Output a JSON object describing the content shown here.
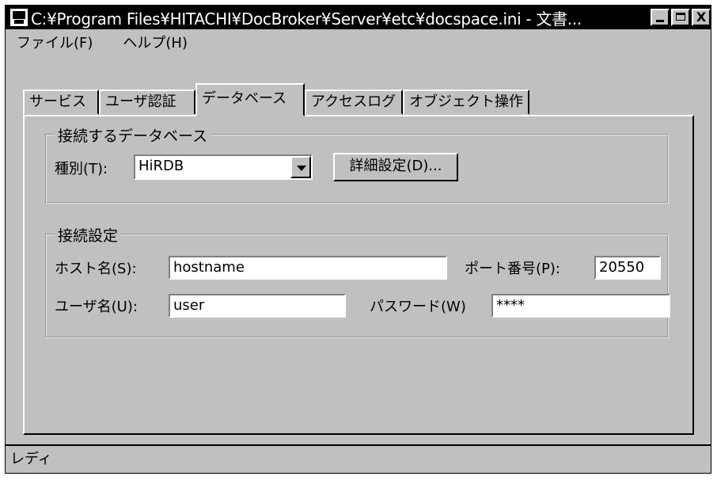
{
  "window": {
    "title": "C:¥Program Files¥HITACHI¥DocBroker¥Server¥etc¥docspace.ini - 文書...",
    "controls": {
      "minimize": "_",
      "maximize": "□",
      "close": "X"
    }
  },
  "menu": [
    "ファイル(F)",
    "ヘルプ(H)"
  ],
  "tabs": [
    {
      "label": "サービス",
      "active": false
    },
    {
      "label": "ユーザ認証",
      "active": false
    },
    {
      "label": "データベース",
      "active": true
    },
    {
      "label": "アクセスログ",
      "active": false
    },
    {
      "label": "オブジェクト操作",
      "active": false
    }
  ],
  "db_group": {
    "title": "接続するデータベース",
    "type_label": "種別(T):",
    "type_value": "HiRDB",
    "detail_button": "詳細設定(D)..."
  },
  "conn_group": {
    "title": "接続設定",
    "host_label": "ホスト名(S):",
    "host_value": "hostname",
    "port_label": "ポート番号(P):",
    "port_value": "20550",
    "user_label": "ユーザ名(U):",
    "user_value": "user",
    "password_label": "パスワード(W)",
    "password_value": "****"
  },
  "status": "レディ"
}
